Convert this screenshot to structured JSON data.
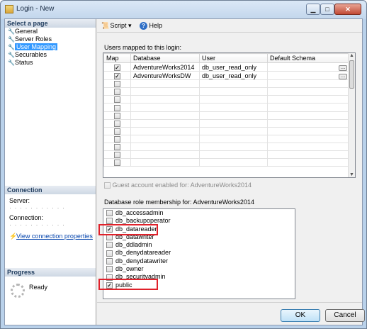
{
  "window": {
    "title": "Login - New"
  },
  "left": {
    "select_page_header": "Select a page",
    "pages": [
      {
        "label": "General"
      },
      {
        "label": "Server Roles"
      },
      {
        "label": "User Mapping"
      },
      {
        "label": "Securables"
      },
      {
        "label": "Status"
      }
    ],
    "connection_header": "Connection",
    "server_label": "Server:",
    "connection_label": "Connection:",
    "view_conn_link": "View connection properties",
    "progress_header": "Progress",
    "progress_status": "Ready"
  },
  "toolbar": {
    "script_label": "Script",
    "help_label": "Help"
  },
  "users": {
    "section_label": "Users mapped to this login:",
    "columns": [
      "Map",
      "Database",
      "User",
      "Default Schema"
    ],
    "rows": [
      {
        "checked": true,
        "database": "AdventureWorks2014",
        "user": "db_user_read_only"
      },
      {
        "checked": true,
        "database": "AdventureWorksDW",
        "user": "db_user_read_only"
      },
      {
        "checked": false,
        "database": "",
        "user": ""
      },
      {
        "checked": false,
        "database": "",
        "user": ""
      },
      {
        "checked": false,
        "database": "",
        "user": ""
      },
      {
        "checked": false,
        "database": "",
        "user": ""
      },
      {
        "checked": false,
        "database": "",
        "user": ""
      },
      {
        "checked": false,
        "database": "",
        "user": ""
      },
      {
        "checked": false,
        "database": "",
        "user": ""
      },
      {
        "checked": false,
        "database": "",
        "user": ""
      },
      {
        "checked": false,
        "database": "",
        "user": ""
      },
      {
        "checked": false,
        "database": "",
        "user": ""
      },
      {
        "checked": false,
        "database": "",
        "user": ""
      }
    ],
    "guest_label": "Guest account enabled for: AdventureWorks2014"
  },
  "roles": {
    "section_label": "Database role membership for: AdventureWorks2014",
    "items": [
      {
        "label": "db_accessadmin",
        "checked": false
      },
      {
        "label": "db_backupoperator",
        "checked": false
      },
      {
        "label": "db_datareader",
        "checked": true
      },
      {
        "label": "db_datawriter",
        "checked": false
      },
      {
        "label": "db_ddladmin",
        "checked": false
      },
      {
        "label": "db_denydatareader",
        "checked": false
      },
      {
        "label": "db_denydatawriter",
        "checked": false
      },
      {
        "label": "db_owner",
        "checked": false
      },
      {
        "label": "db_securityadmin",
        "checked": false
      },
      {
        "label": "public",
        "checked": true
      }
    ]
  },
  "footer": {
    "ok_label": "OK",
    "cancel_label": "Cancel"
  }
}
